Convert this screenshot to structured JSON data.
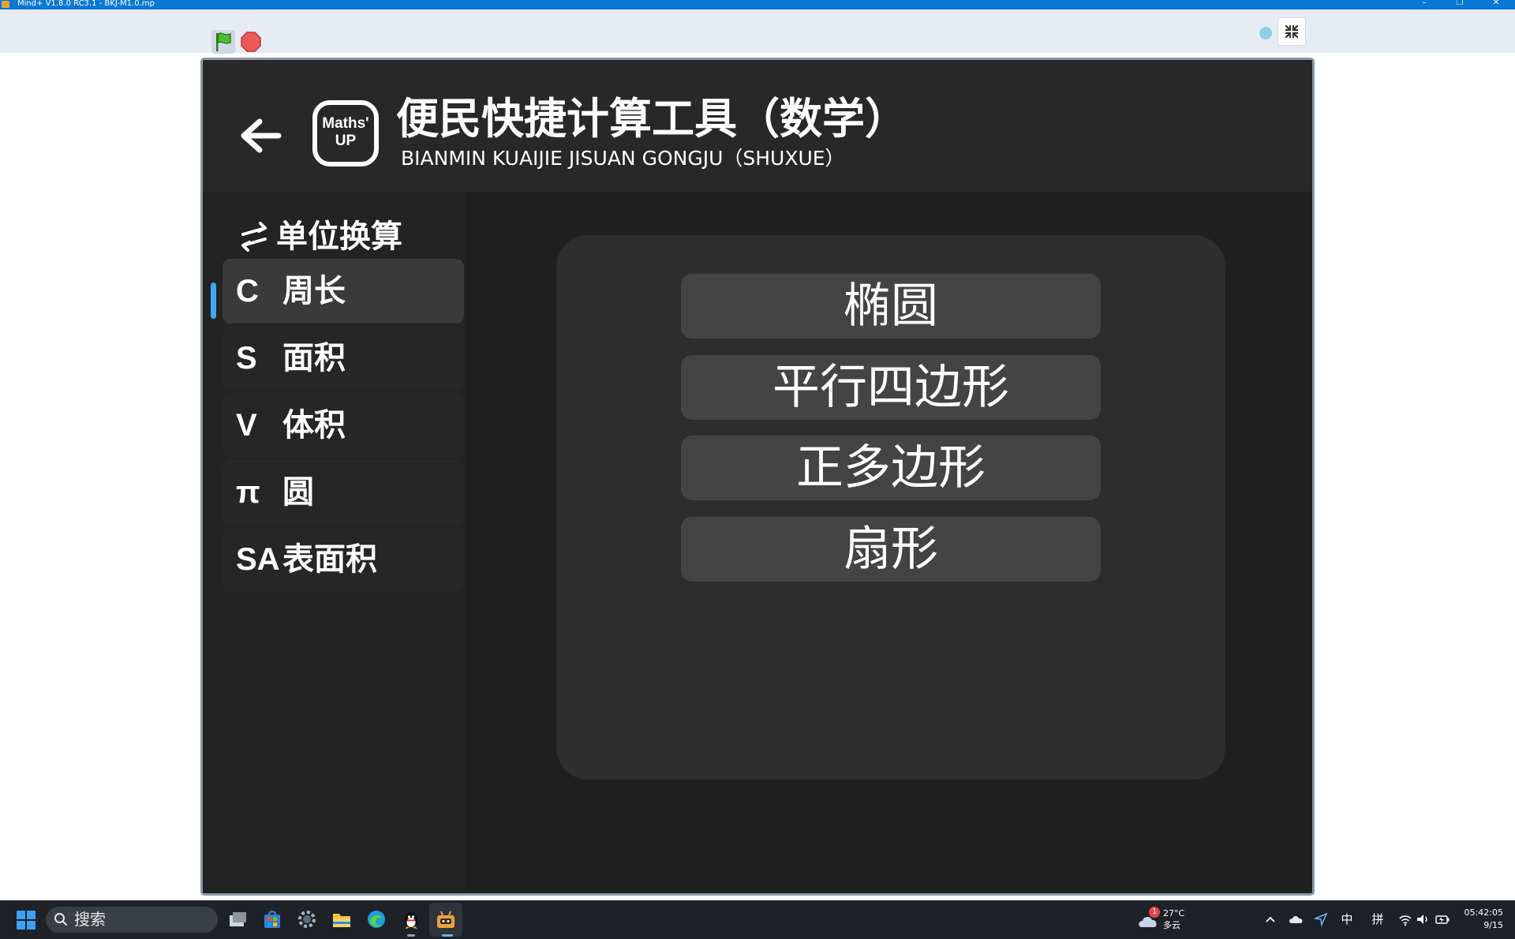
{
  "window": {
    "title": "Mind+ V1.8.0 RC3.1 - BKJ-M1.0.mp"
  },
  "app": {
    "title": "便民快捷计算工具（数学）",
    "subtitle": "BIANMIN KUAIJIE JISUAN GONGJU（SHUXUE）",
    "logo_line1": "Maths'",
    "logo_line2": "UP"
  },
  "sidebar": {
    "heading": "单位换算",
    "items": [
      {
        "symbol": "C",
        "label": "周长",
        "active": true
      },
      {
        "symbol": "S",
        "label": "面积",
        "active": false
      },
      {
        "symbol": "V",
        "label": "体积",
        "active": false
      },
      {
        "symbol": "π",
        "label": "圆",
        "active": false
      },
      {
        "symbol": "SA",
        "label": "表面积",
        "active": false
      }
    ]
  },
  "shapes": [
    "椭圆",
    "平行四边形",
    "正多边形",
    "扇形"
  ],
  "taskbar": {
    "search_placeholder": "搜索",
    "weather_temp": "27°C",
    "weather_desc": "多云",
    "weather_badge": "1",
    "ime_lang": "中",
    "ime_mode": "拼",
    "time": "05:42:05",
    "date": "9/15"
  },
  "colors": {
    "accent": "#3da9f0",
    "stage_bg": "#202020",
    "header_bg": "#282828",
    "panel_bg": "#2d2d2d",
    "button_bg": "#444444",
    "titlebar": "#0a78d4"
  }
}
